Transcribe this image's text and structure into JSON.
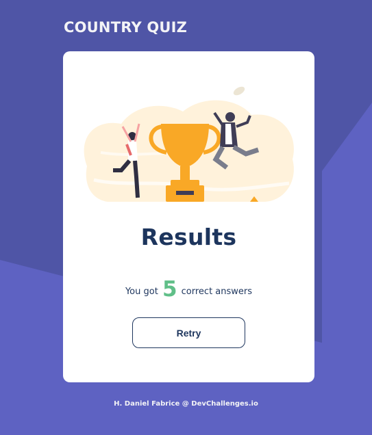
{
  "colors": {
    "background": "#4f55a6",
    "background_accent": "#5e62c2",
    "card": "#ffffff",
    "title_text": "#1d355d",
    "score_accent": "#60bf88",
    "trophy": "#f9a826"
  },
  "header": {
    "title": "COUNTRY QUIZ"
  },
  "results": {
    "heading": "Results",
    "prefix": "You got",
    "score": "5",
    "suffix": "correct answers",
    "retry_label": "Retry"
  },
  "footer": {
    "credit": "H. Daniel Fabrice @ DevChallenges.io"
  }
}
